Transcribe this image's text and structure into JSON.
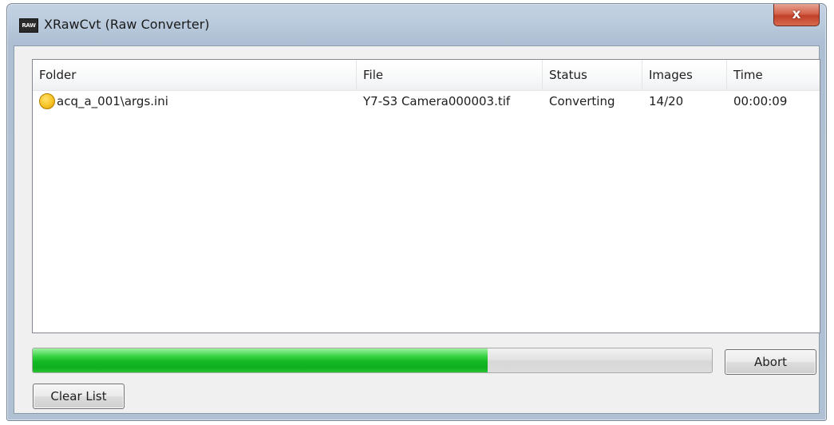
{
  "window": {
    "title": "XRawCvt (Raw Converter)",
    "app_icon_text": "RAW",
    "close_glyph": "x"
  },
  "list": {
    "columns": [
      "Folder",
      "File",
      "Status",
      "Images",
      "Time"
    ],
    "rows": [
      {
        "status_icon": "yellow-circle-icon",
        "folder": "acq_a_001\\args.ini",
        "file": "Y7-S3 Camera000003.tif",
        "status": "Converting",
        "images": "14/20",
        "time": "00:00:09"
      }
    ]
  },
  "progress": {
    "value": 0.67,
    "color": "#12b922"
  },
  "buttons": {
    "abort": "Abort",
    "clear_list": "Clear List"
  }
}
